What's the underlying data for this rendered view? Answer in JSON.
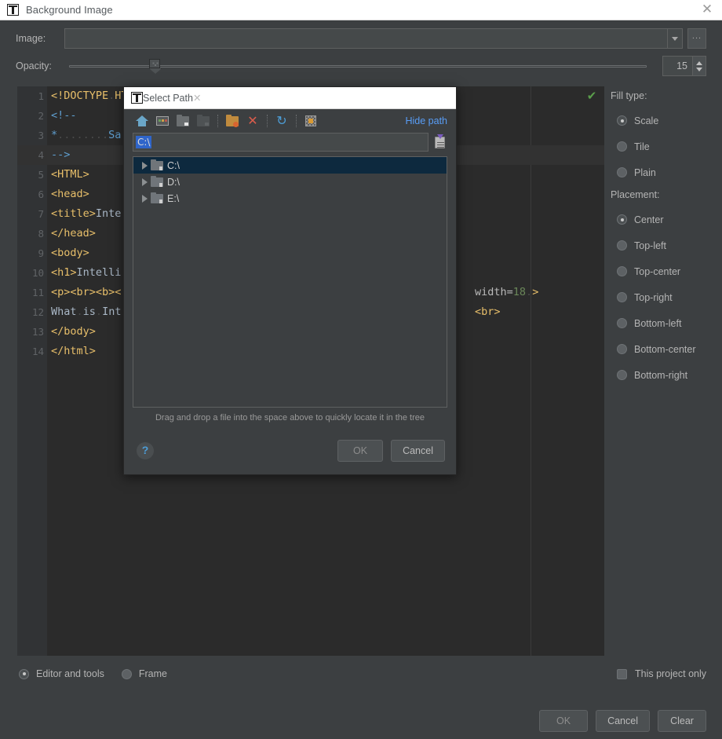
{
  "window": {
    "title": "Background Image",
    "close_label": "✕",
    "app_icon": "intellij-idea-logo"
  },
  "form": {
    "image_label": "Image:",
    "image_value": "",
    "image_placeholder": "",
    "browse_label": "...",
    "opacity_label": "Opacity:",
    "opacity_value": "15"
  },
  "editor": {
    "inspection_check": "✔",
    "lines": [
      {
        "num": "1",
        "text": "<!DOCTYPE HTML PUBLIC \"-//W3C//DTD HTML 4.01//EN\" \"http://www.w3.org/TR/html4/strict.dtd\">"
      },
      {
        "num": "2",
        "text": "<!--"
      },
      {
        "num": "3",
        "text": "*         Sample HTML file"
      },
      {
        "num": "4",
        "text": "-->"
      },
      {
        "num": "5",
        "text": "<HTML>"
      },
      {
        "num": "6",
        "text": "<head>"
      },
      {
        "num": "7",
        "text": "<title>IntelliJ IDEA</title>"
      },
      {
        "num": "8",
        "text": "</head>"
      },
      {
        "num": "9",
        "text": "<body>"
      },
      {
        "num": "10",
        "text": "<h1>IntelliJ IDEA</h1>"
      },
      {
        "num": "11",
        "text": "<p><br><b><img src=\"logo.png\" height=18 width=18 >"
      },
      {
        "num": "12",
        "text": "What is IntelliJ IDEA?<br>"
      },
      {
        "num": "13",
        "text": "</body>"
      },
      {
        "num": "14",
        "text": "</html>"
      }
    ],
    "visible_right_fragments": [
      "width=18 >",
      "<br>"
    ]
  },
  "options": {
    "fill_type_label": "Fill type:",
    "fill_types": [
      {
        "label": "Scale",
        "selected": true
      },
      {
        "label": "Tile",
        "selected": false
      },
      {
        "label": "Plain",
        "selected": false
      }
    ],
    "placement_label": "Placement:",
    "placements": [
      {
        "label": "Center",
        "selected": true
      },
      {
        "label": "Top-left",
        "selected": false
      },
      {
        "label": "Top-center",
        "selected": false
      },
      {
        "label": "Top-right",
        "selected": false
      },
      {
        "label": "Bottom-left",
        "selected": false
      },
      {
        "label": "Bottom-center",
        "selected": false
      },
      {
        "label": "Bottom-right",
        "selected": false
      }
    ]
  },
  "scope": {
    "editor_and_tools": "Editor and tools",
    "frame": "Frame",
    "this_project_only": "This project only",
    "this_project_only_checked": false
  },
  "footer": {
    "ok": "OK",
    "cancel": "Cancel",
    "clear": "Clear"
  },
  "select_path": {
    "title": "Select Path",
    "close_label": "✕",
    "hide_path_link": "Hide path",
    "path_value": "C:\\",
    "hint": "Drag and drop a file into the space above to quickly locate it in the tree",
    "help_label": "?",
    "ok": "OK",
    "cancel": "Cancel",
    "toolbar": [
      {
        "name": "home-icon",
        "tooltip": "Home"
      },
      {
        "name": "desktop-icon",
        "tooltip": "Desktop"
      },
      {
        "name": "folder-icon",
        "tooltip": "Project"
      },
      {
        "name": "folder-disabled-icon",
        "tooltip": "Module"
      },
      {
        "name": "new-folder-icon",
        "tooltip": "New Folder"
      },
      {
        "name": "delete-icon",
        "tooltip": "Delete"
      },
      {
        "name": "refresh-icon",
        "tooltip": "Refresh"
      },
      {
        "name": "show-hidden-icon",
        "tooltip": "Show Hidden Files"
      }
    ],
    "tree": [
      {
        "label": "C:\\",
        "selected": true,
        "expanded": false
      },
      {
        "label": "D:\\",
        "selected": false,
        "expanded": false
      },
      {
        "label": "E:\\",
        "selected": false,
        "expanded": false
      }
    ]
  },
  "colors": {
    "window_bg": "#3c3f41",
    "editor_bg": "#2b2b2b",
    "titlebar_bg": "#ffffff",
    "accent_link": "#589df6",
    "selection_blue": "#2f65ca",
    "tree_selection": "#0d293e",
    "tag_color": "#e8bf6a",
    "comment_color": "#5f9fd0",
    "number_color": "#6a8759",
    "check_green": "#5a9e4b"
  }
}
